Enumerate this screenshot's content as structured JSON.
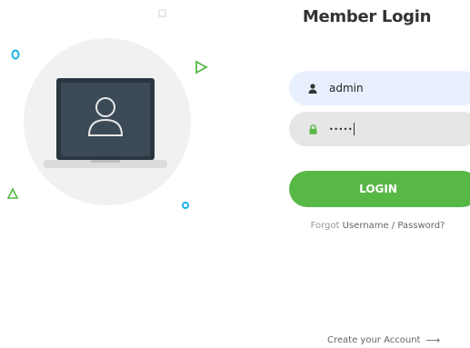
{
  "login": {
    "title": "Member Login",
    "username_value": "admin",
    "password_value": "•••••",
    "login_button_label": "LOGIN",
    "forgot_prefix": "Forgot",
    "forgot_link": "Username / Password?",
    "create_account_label": "Create your Account",
    "icons": {
      "username": "user-icon",
      "password": "lock-icon",
      "create_arrow": "arrow-right-icon",
      "illustration": "laptop-user-icon"
    }
  },
  "colors": {
    "accent": "#57b846",
    "username_bg": "#e8f0fe",
    "password_bg": "#e6e6e6",
    "title": "#333333",
    "muted_text": "#999999",
    "circle_bg": "#f1f1f1",
    "laptop_screen": "#3c4a57",
    "deco_blue": "#1ab2e8",
    "deco_green": "#57b846"
  }
}
